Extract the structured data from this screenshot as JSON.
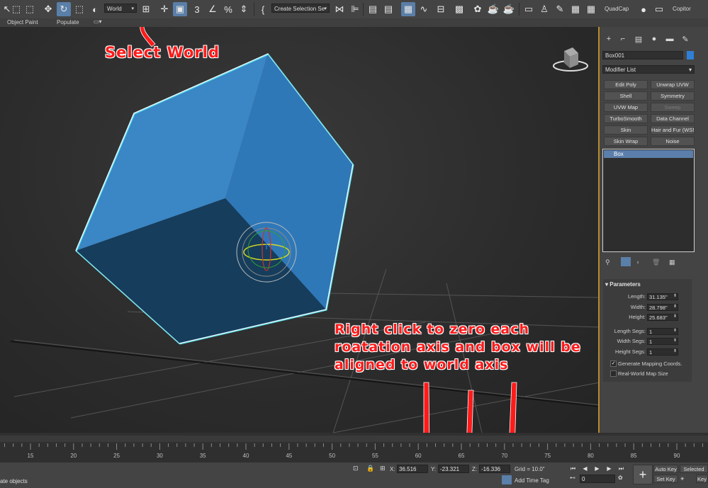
{
  "toolbar": {
    "coord_system": "World",
    "selection_set_placeholder": "Create Selection Se",
    "workspace_label": "QuadCap",
    "copitor_label": "Copitor"
  },
  "ribbon": {
    "object_paint": "Object Paint",
    "populate": "Populate"
  },
  "annotations": {
    "select_world": "Select World",
    "right_click_line1": "Right click to zero each",
    "right_click_line2": "roatation axis and box will be",
    "right_click_line3": "aligned to world axis"
  },
  "command_panel": {
    "object_name": "Box001",
    "object_color": "#2f7fd6",
    "modifier_list_label": "Modifier List",
    "modifier_buttons": [
      {
        "label": "Edit Poly",
        "enabled": true
      },
      {
        "label": "Unwrap UVW",
        "enabled": true
      },
      {
        "label": "Shell",
        "enabled": true
      },
      {
        "label": "Symmetry",
        "enabled": true
      },
      {
        "label": "UVW Map",
        "enabled": true
      },
      {
        "label": "Sweep",
        "enabled": false
      },
      {
        "label": "TurboSmooth",
        "enabled": true
      },
      {
        "label": "Data Channel",
        "enabled": true
      },
      {
        "label": "Skin",
        "enabled": true
      },
      {
        "label": "Hair and Fur (WSM",
        "enabled": true
      },
      {
        "label": "Skin Wrap",
        "enabled": true
      },
      {
        "label": "Noise",
        "enabled": true
      }
    ],
    "stack_item": "Box",
    "parameters": {
      "title": "Parameters",
      "length_label": "Length:",
      "length_value": "31.135\"",
      "width_label": "Width:",
      "width_value": "28.798\"",
      "height_label": "Height:",
      "height_value": "25.683\"",
      "length_segs_label": "Length Segs:",
      "length_segs_value": "1",
      "width_segs_label": "Width Segs:",
      "width_segs_value": "1",
      "height_segs_label": "Height Segs:",
      "height_segs_value": "1",
      "gen_mapping_label": "Generate Mapping Coords.",
      "gen_mapping_checked": true,
      "real_world_label": "Real-World Map Size",
      "real_world_checked": false
    }
  },
  "timeline": {
    "ticks": [
      "15",
      "20",
      "25",
      "30",
      "35",
      "40",
      "45",
      "50",
      "55",
      "60",
      "65",
      "70",
      "75",
      "80",
      "85",
      "90"
    ]
  },
  "status": {
    "prompt_text": "ate objects",
    "x_label": "X:",
    "x_value": "36.516",
    "y_label": "Y:",
    "y_value": "-23.321",
    "z_label": "Z:",
    "z_value": "-16.336",
    "grid_text": "Grid = 10.0\"",
    "add_time_tag": "Add Time Tag",
    "auto_key": "Auto Key",
    "selected": "Selected",
    "set_key": "Set Key",
    "key_filters": "Key",
    "frame_value": "0"
  },
  "colors": {
    "selection_cyan": "#4fe6f0",
    "box_front": "#3b86c4",
    "box_right": "#2f78b8",
    "box_bottom": "#163d5c",
    "annotation_red": "#ff1a1a",
    "viewport_border": "#b88b2a"
  }
}
